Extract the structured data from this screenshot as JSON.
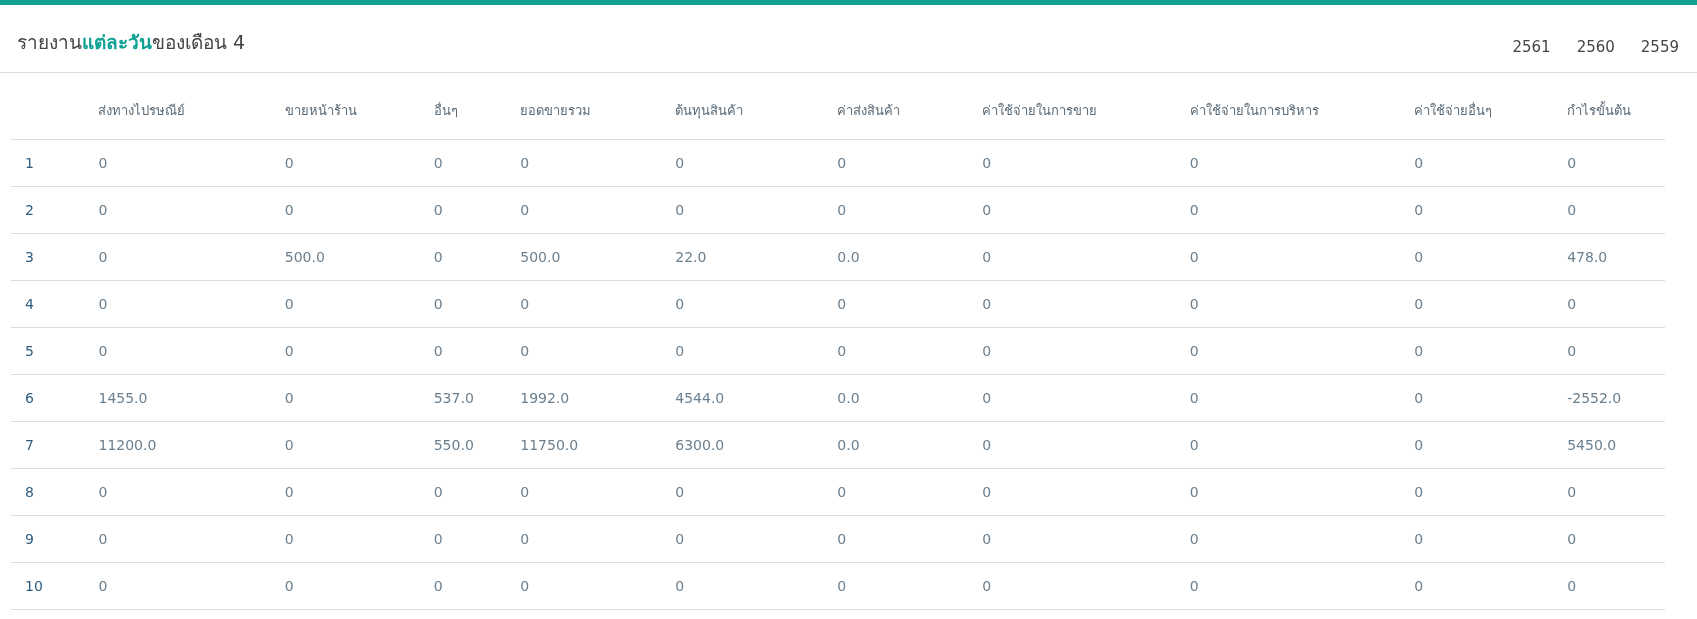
{
  "title": "รายงาน**แต่ละวัน**ของเดือน 4",
  "years": [
    "2561",
    "2560",
    "2559"
  ],
  "table": {
    "columns": [
      "ส่งทางไปรษณีย์",
      "ขายหน้าร้าน",
      "อื่นๆ",
      "ยอดขายรวม",
      "ต้นทุนสินค้า",
      "ค่าส่งสินค้า",
      "ค่าใช้จ่ายในการขาย",
      "ค่าใช้จ่ายในการบริหาร",
      "ค่าใช้จ่ายอื่นๆ",
      "กำไรขั้นต้น"
    ],
    "rows": [
      {
        "day": "1",
        "cells": [
          "0",
          "0",
          "0",
          "0",
          "0",
          "0",
          "0",
          "0",
          "0",
          "0"
        ]
      },
      {
        "day": "2",
        "cells": [
          "0",
          "0",
          "0",
          "0",
          "0",
          "0",
          "0",
          "0",
          "0",
          "0"
        ]
      },
      {
        "day": "3",
        "cells": [
          "0",
          "500.0",
          "0",
          "500.0",
          "22.0",
          "0.0",
          "0",
          "0",
          "0",
          "478.0"
        ]
      },
      {
        "day": "4",
        "cells": [
          "0",
          "0",
          "0",
          "0",
          "0",
          "0",
          "0",
          "0",
          "0",
          "0"
        ]
      },
      {
        "day": "5",
        "cells": [
          "0",
          "0",
          "0",
          "0",
          "0",
          "0",
          "0",
          "0",
          "0",
          "0"
        ]
      },
      {
        "day": "6",
        "cells": [
          "1455.0",
          "0",
          "537.0",
          "1992.0",
          "4544.0",
          "0.0",
          "0",
          "0",
          "0",
          "-2552.0"
        ]
      },
      {
        "day": "7",
        "cells": [
          "11200.0",
          "0",
          "550.0",
          "11750.0",
          "6300.0",
          "0.0",
          "0",
          "0",
          "0",
          "5450.0"
        ]
      },
      {
        "day": "8",
        "cells": [
          "0",
          "0",
          "0",
          "0",
          "0",
          "0",
          "0",
          "0",
          "0",
          "0"
        ]
      },
      {
        "day": "9",
        "cells": [
          "0",
          "0",
          "0",
          "0",
          "0",
          "0",
          "0",
          "0",
          "0",
          "0"
        ]
      },
      {
        "day": "10",
        "cells": [
          "0",
          "0",
          "0",
          "0",
          "0",
          "0",
          "0",
          "0",
          "0",
          "0"
        ]
      }
    ]
  }
}
